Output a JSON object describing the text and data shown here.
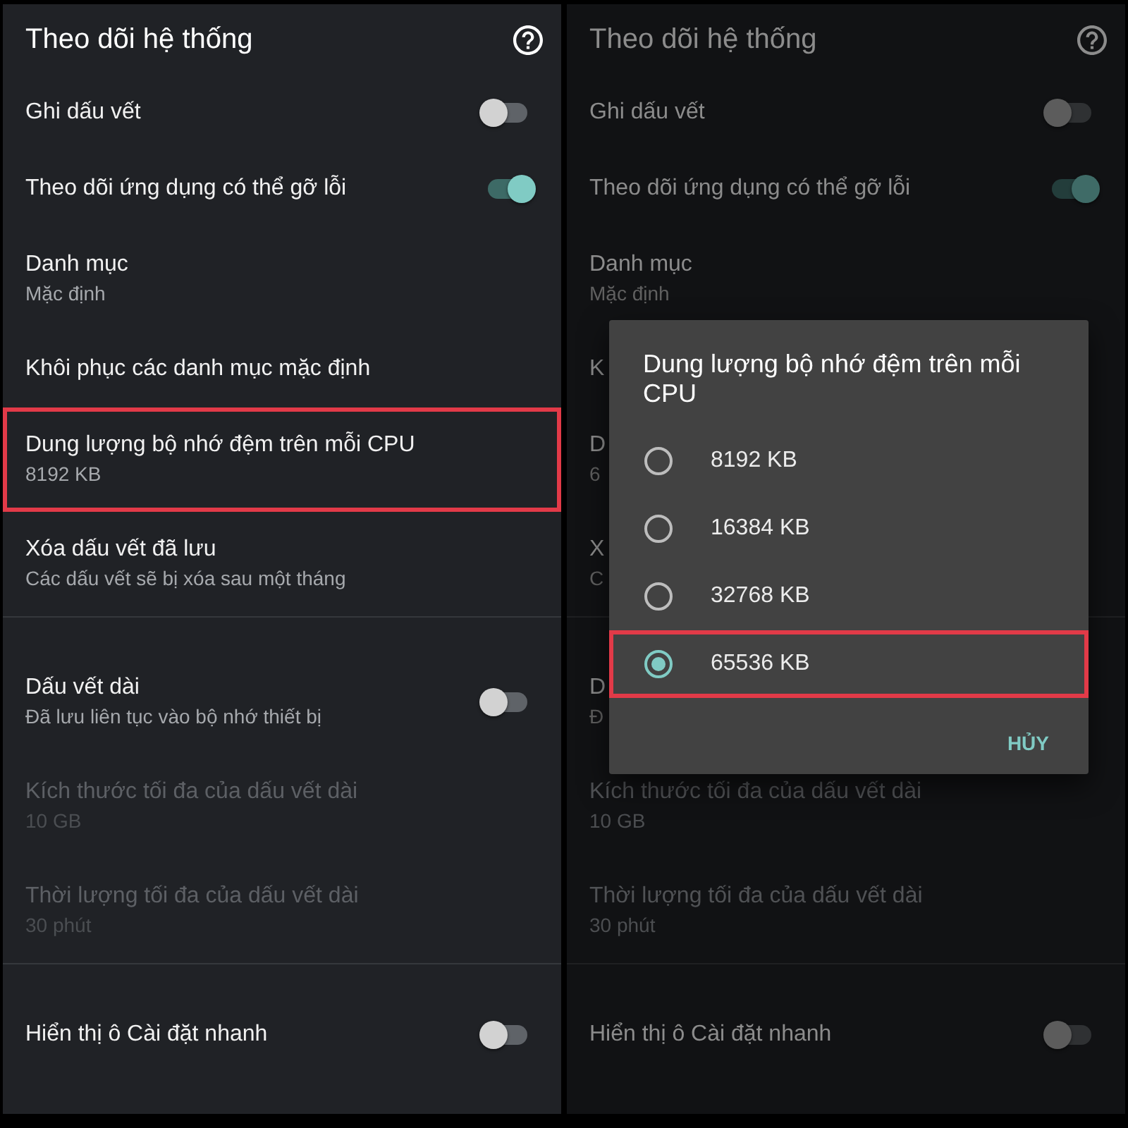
{
  "screens": [
    {
      "dimmed": false,
      "title": "Theo dõi hệ thống",
      "sections": [
        {
          "items": [
            {
              "kind": "switch",
              "title": "Ghi dấu vết",
              "on": false,
              "disabled": false,
              "highlighted": false
            },
            {
              "kind": "switch",
              "title": "Theo dõi ứng dụng có thể gỡ lỗi",
              "on": true,
              "disabled": false,
              "highlighted": false
            },
            {
              "kind": "text",
              "title": "Danh mục",
              "summary": "Mặc định",
              "disabled": false,
              "highlighted": false
            },
            {
              "kind": "text",
              "title": "Khôi phục các danh mục mặc định",
              "disabled": false,
              "highlighted": false
            },
            {
              "kind": "text",
              "title": "Dung lượng bộ nhớ đệm trên mỗi CPU",
              "summary": "8192 KB",
              "disabled": false,
              "highlighted": true
            },
            {
              "kind": "text",
              "title": "Xóa dấu vết đã lưu",
              "summary": "Các dấu vết sẽ bị xóa sau một tháng",
              "disabled": false,
              "highlighted": false
            }
          ]
        },
        {
          "items": [
            {
              "kind": "switch",
              "title": "Dấu vết dài",
              "summary": "Đã lưu liên tục vào bộ nhớ thiết bị",
              "on": false,
              "disabled": false,
              "highlighted": false
            },
            {
              "kind": "text",
              "title": "Kích thước tối đa của dấu vết dài",
              "summary": "10 GB",
              "disabled": true,
              "highlighted": false
            },
            {
              "kind": "text",
              "title": "Thời lượng tối đa của dấu vết dài",
              "summary": "30 phút",
              "disabled": true,
              "highlighted": false
            }
          ]
        },
        {
          "items": [
            {
              "kind": "switch",
              "title": "Hiển thị ô Cài đặt nhanh",
              "on": false,
              "disabled": false,
              "highlighted": false
            }
          ]
        }
      ]
    },
    {
      "dimmed": true,
      "title": "Theo dõi hệ thống",
      "sections": [
        {
          "items": [
            {
              "kind": "switch",
              "title": "Ghi dấu vết",
              "on": false,
              "disabled": false,
              "highlighted": false
            },
            {
              "kind": "switch",
              "title": "Theo dõi ứng dụng có thể gỡ lỗi",
              "on": true,
              "disabled": false,
              "highlighted": false
            },
            {
              "kind": "text",
              "title": "Danh mục",
              "summary": "Mặc định",
              "disabled": false,
              "highlighted": false
            },
            {
              "kind": "text",
              "title": "K",
              "disabled": false,
              "highlighted": false
            },
            {
              "kind": "text",
              "title": "D",
              "summary": "6",
              "disabled": false,
              "highlighted": false
            },
            {
              "kind": "text",
              "title": "X",
              "summary": "C",
              "disabled": false,
              "highlighted": false
            }
          ]
        },
        {
          "items": [
            {
              "kind": "text",
              "title": "D",
              "summary": "Đ",
              "disabled": false,
              "highlighted": false
            },
            {
              "kind": "text",
              "title": "Kích thước tối đa của dấu vết dài",
              "summary": "10 GB",
              "disabled": true,
              "highlighted": false
            },
            {
              "kind": "text",
              "title": "Thời lượng tối đa của dấu vết dài",
              "summary": "30 phút",
              "disabled": true,
              "highlighted": false
            }
          ]
        },
        {
          "items": [
            {
              "kind": "switch",
              "title": "Hiển thị ô Cài đặt nhanh",
              "on": false,
              "disabled": false,
              "highlighted": false
            }
          ]
        }
      ],
      "dialog": {
        "title": "Dung lượng bộ nhớ đệm trên mỗi CPU",
        "options": [
          {
            "label": "8192 KB",
            "selected": false,
            "highlighted": false
          },
          {
            "label": "16384 KB",
            "selected": false,
            "highlighted": false
          },
          {
            "label": "32768 KB",
            "selected": false,
            "highlighted": false
          },
          {
            "label": "65536 KB",
            "selected": true,
            "highlighted": true
          }
        ],
        "buttons": [
          {
            "kind": "cancel",
            "label": "HỦY"
          }
        ]
      }
    }
  ]
}
